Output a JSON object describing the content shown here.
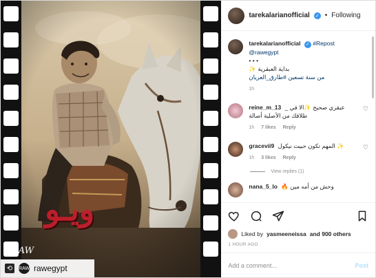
{
  "photo": {
    "watermark_text": "ويـو",
    "raw_mark": "RAW",
    "repost_name": "rawegypt"
  },
  "header": {
    "username": "tarekalarianofficial",
    "follow_label": "Following",
    "verified_icon": "verified-badge-icon"
  },
  "caption": {
    "username": "tarekalarianofficial",
    "tag_repost": "#Repost",
    "tag_user": "@rawegypt",
    "dots": "• • •",
    "line1": "بداية العبقرية ✨",
    "line2": "من سنة تسعين #طارق_العريان",
    "time": "1h"
  },
  "comments": [
    {
      "username": "reine_m_13",
      "text": "عبقري صحيح ✨الا في _ طلاقك من الأصلية أصالة",
      "time": "1h",
      "likes": "7 likes",
      "reply": "Reply"
    },
    {
      "username": "gracevii9",
      "text": "✨ المهم تكون حبيت نيكول",
      "time": "1h",
      "likes": "3 likes",
      "reply": "Reply"
    },
    {
      "username": "nana_5_lo",
      "text": "وحش من أمه مين 🔥",
      "time": "",
      "likes": "",
      "reply": ""
    }
  ],
  "view_replies": "View replies (1)",
  "likes_line": {
    "prefix": "Liked by",
    "user": "yasmeeneissa",
    "suffix": "and 900 others"
  },
  "time_ago": "1 HOUR AGO",
  "add_comment": {
    "placeholder": "Add a comment...",
    "post_label": "Post"
  },
  "colors": {
    "link": "#00376b",
    "verified": "#3897f0",
    "watermark": "#c71e2d"
  }
}
